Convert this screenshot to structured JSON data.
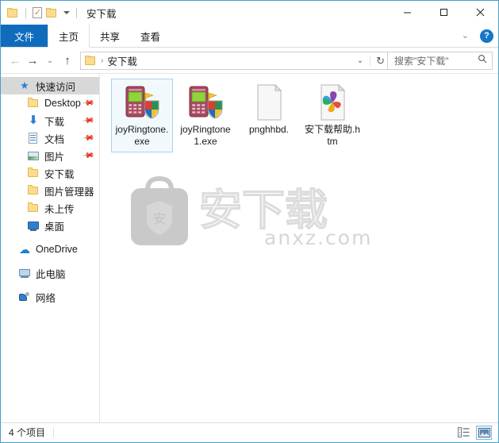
{
  "window": {
    "title": "安下载",
    "quick_access_toolbar": [
      {
        "name": "folder-icon",
        "label": ""
      },
      {
        "name": "properties-icon",
        "label": ""
      },
      {
        "name": "new-folder-icon",
        "label": ""
      },
      {
        "name": "chevron-down-icon",
        "label": ""
      }
    ],
    "controls": {
      "minimize": "–",
      "maximize": "□",
      "close": "✕"
    }
  },
  "ribbon": {
    "tabs": [
      {
        "label": "文件",
        "active": true
      },
      {
        "label": "主页",
        "active": false
      },
      {
        "label": "共享",
        "active": false
      },
      {
        "label": "查看",
        "active": false
      }
    ],
    "collapse_chevron": "⌄",
    "help_label": "?"
  },
  "navbar": {
    "back": "←",
    "forward": "→",
    "history": "⌄",
    "up": "↑",
    "breadcrumb": {
      "separator": "›",
      "items": [
        "安下载"
      ]
    },
    "dropdown_chevron": "⌄",
    "refresh": "↻"
  },
  "search": {
    "placeholder": "搜索\"安下载\"",
    "icon": "search-icon"
  },
  "sidebar": {
    "items": [
      {
        "label": "快速访问",
        "icon": "star-icon",
        "selected": true,
        "pinned": false,
        "level": 1
      },
      {
        "label": "Desktop",
        "icon": "folder-icon",
        "selected": false,
        "pinned": true,
        "level": 2
      },
      {
        "label": "下载",
        "icon": "download-icon",
        "selected": false,
        "pinned": true,
        "level": 2
      },
      {
        "label": "文档",
        "icon": "document-icon",
        "selected": false,
        "pinned": true,
        "level": 2
      },
      {
        "label": "图片",
        "icon": "picture-icon",
        "selected": false,
        "pinned": true,
        "level": 2
      },
      {
        "label": "安下载",
        "icon": "folder-icon",
        "selected": false,
        "pinned": false,
        "level": 2
      },
      {
        "label": "图片管理器",
        "icon": "folder-icon",
        "selected": false,
        "pinned": false,
        "level": 2
      },
      {
        "label": "未上传",
        "icon": "folder-icon",
        "selected": false,
        "pinned": false,
        "level": 2
      },
      {
        "label": "桌面",
        "icon": "desktop-icon",
        "selected": false,
        "pinned": false,
        "level": 2
      },
      {
        "label": "OneDrive",
        "icon": "cloud-icon",
        "selected": false,
        "pinned": false,
        "level": 1
      },
      {
        "label": "此电脑",
        "icon": "computer-icon",
        "selected": false,
        "pinned": false,
        "level": 1
      },
      {
        "label": "网络",
        "icon": "network-icon",
        "selected": false,
        "pinned": false,
        "level": 1
      }
    ],
    "pin_glyph": "📌"
  },
  "files": [
    {
      "name": "joyRingtone.exe",
      "icon": "exe-shield-icon",
      "selected": true
    },
    {
      "name": "joyRingtone1.exe",
      "icon": "exe-shield-icon",
      "selected": false
    },
    {
      "name": "pnghhbd.",
      "icon": "blank-file-icon",
      "selected": false
    },
    {
      "name": "安下载帮助.htm",
      "icon": "pinwheel-html-icon",
      "selected": false
    }
  ],
  "watermark": {
    "brand_char": "安",
    "url_text": "anxz.com"
  },
  "statusbar": {
    "item_count": "4 个项目",
    "views": [
      {
        "name": "details-view-button",
        "active": false
      },
      {
        "name": "large-icons-view-button",
        "active": true
      }
    ]
  },
  "colors": {
    "accent": "#0f6cbd",
    "selection_border": "#a6d3ef",
    "selection_fill": "#f2f9fd",
    "window_border": "#4a9ec7",
    "folder_yellow": "#fbdc90",
    "watermark_gray": "#d6d6d6"
  }
}
